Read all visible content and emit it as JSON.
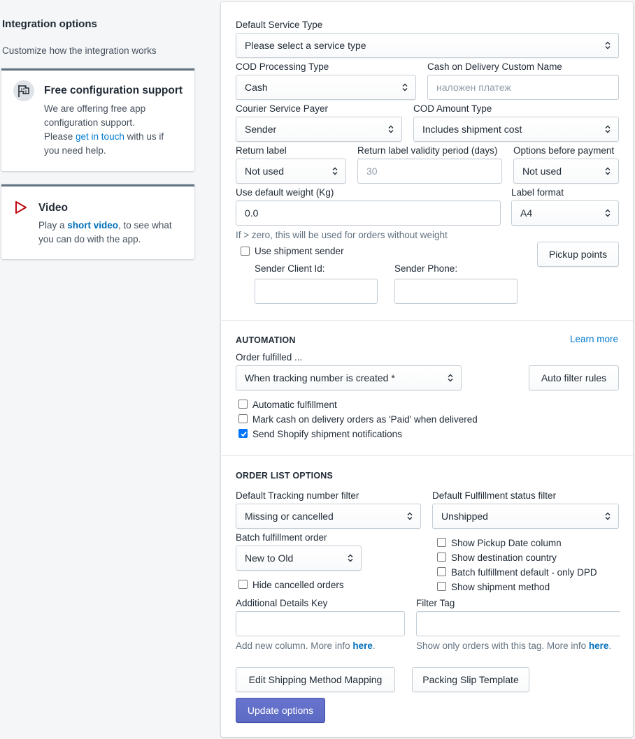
{
  "sidebar": {
    "title": "Integration options",
    "description": "Customize how the integration works",
    "support_card": {
      "heading": "Free configuration support",
      "line1": "We are offering free app",
      "line2": "configuration support.",
      "line3_before": "Please ",
      "line3_link": "get in touch",
      "line3_after": " with us if",
      "line4": "you need help.",
      "icon": "flag-icon"
    },
    "video_card": {
      "heading": "Video",
      "line1_before": "Play a ",
      "line1_link": "short video",
      "line1_after": ", to see what",
      "line2": "you can do with the app.",
      "icon": "play-icon",
      "icon_color": "#bf0711"
    }
  },
  "settings": {
    "default_service_type": {
      "label": "Default Service Type",
      "value": "Please select a service type"
    },
    "cod_processing_type": {
      "label": "COD Processing Type",
      "value": "Cash"
    },
    "cod_custom_name": {
      "label": "Cash on Delivery Custom Name",
      "placeholder": "наложен платеж"
    },
    "courier_service_payer": {
      "label": "Courier Service Payer",
      "value": "Sender"
    },
    "cod_amount_type": {
      "label": "COD Amount Type",
      "value": "Includes shipment cost"
    },
    "return_label": {
      "label": "Return label",
      "value": "Not used"
    },
    "return_label_validity": {
      "label": "Return label validity period (days)",
      "value": "30"
    },
    "options_before_payment": {
      "label": "Options before payment",
      "value": "Not used"
    },
    "default_weight": {
      "label": "Use default weight (Kg)",
      "value": "0.0",
      "help": "If > zero, this will be used for orders without weight"
    },
    "label_format": {
      "label": "Label format",
      "value": "A4"
    },
    "use_shipment_sender": {
      "label": "Use shipment sender",
      "checked": false
    },
    "pickup_points_button": "Pickup points",
    "sender_client_id": {
      "label": "Sender Client Id:",
      "value": ""
    },
    "sender_phone": {
      "label": "Sender Phone:",
      "value": ""
    }
  },
  "automation": {
    "title": "AUTOMATION",
    "learn_more": "Learn more",
    "order_fulfilled": {
      "label": "Order fulfilled ...",
      "value": "When tracking number is created *"
    },
    "auto_filter_rules_button": "Auto filter rules",
    "automatic_fulfillment": {
      "label": "Automatic fulfillment",
      "checked": false
    },
    "mark_cod_paid": {
      "label": "Mark cash on delivery orders as 'Paid' when delivered",
      "checked": false
    },
    "send_notifications": {
      "label": "Send Shopify shipment notifications",
      "checked": true
    }
  },
  "order_list": {
    "title": "ORDER LIST OPTIONS",
    "tracking_filter": {
      "label": "Default Tracking number filter",
      "value": "Missing or cancelled"
    },
    "fulfillment_filter": {
      "label": "Default Fulfillment status filter",
      "value": "Unshipped"
    },
    "batch_order": {
      "label": "Batch fulfillment order",
      "value": "New to Old"
    },
    "show_pickup_date": {
      "label": "Show Pickup Date column",
      "checked": false
    },
    "show_destination": {
      "label": "Show destination country",
      "checked": false
    },
    "batch_default_dpd": {
      "label": "Batch fulfillment default - only DPD",
      "checked": false
    },
    "show_shipment_method": {
      "label": "Show shipment method",
      "checked": false
    },
    "hide_cancelled": {
      "label": "Hide cancelled orders",
      "checked": false
    },
    "additional_details_key": {
      "label": "Additional Details Key",
      "value": "",
      "help_before": "Add new column. More info ",
      "help_link": "here",
      "help_after": "."
    },
    "filter_tag": {
      "label": "Filter Tag",
      "value": "",
      "help_before": "Show only orders with this tag. More info ",
      "help_link": "here",
      "help_after": "."
    },
    "edit_mapping_button": "Edit Shipping Method Mapping",
    "packing_slip_button": "Packing Slip Template",
    "update_button": "Update options"
  },
  "colors": {
    "primary": "#5c6ac4",
    "link": "#007ace",
    "checkbox_checked": "#0075ff"
  }
}
